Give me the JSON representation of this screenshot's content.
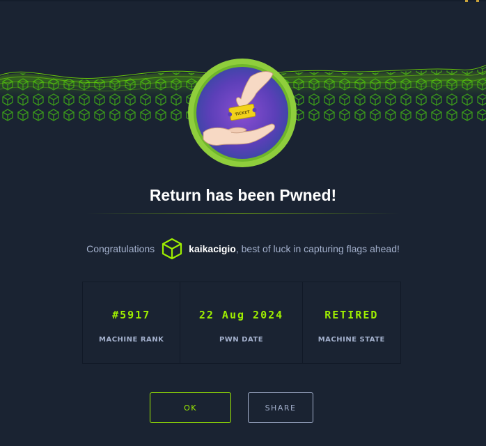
{
  "header": {
    "title": "Return has been Pwned!",
    "badge_icon": "ticket-handoff-icon",
    "badge_ticket_text": "TICKET"
  },
  "congrats": {
    "prefix": "Congratulations",
    "username": "kaikacigio",
    "suffix": ", best of luck in capturing flags ahead!",
    "avatar_icon": "cube-icon"
  },
  "stats": [
    {
      "value": "#5917",
      "label": "MACHINE RANK"
    },
    {
      "value": "22 Aug 2024",
      "label": "PWN DATE"
    },
    {
      "value": "RETIRED",
      "label": "MACHINE STATE"
    }
  ],
  "buttons": {
    "ok": "OK",
    "share": "SHARE"
  },
  "colors": {
    "background": "#1a2332",
    "accent": "#9fef00",
    "text_muted": "#a4b1cd",
    "text_white": "#ffffff"
  }
}
